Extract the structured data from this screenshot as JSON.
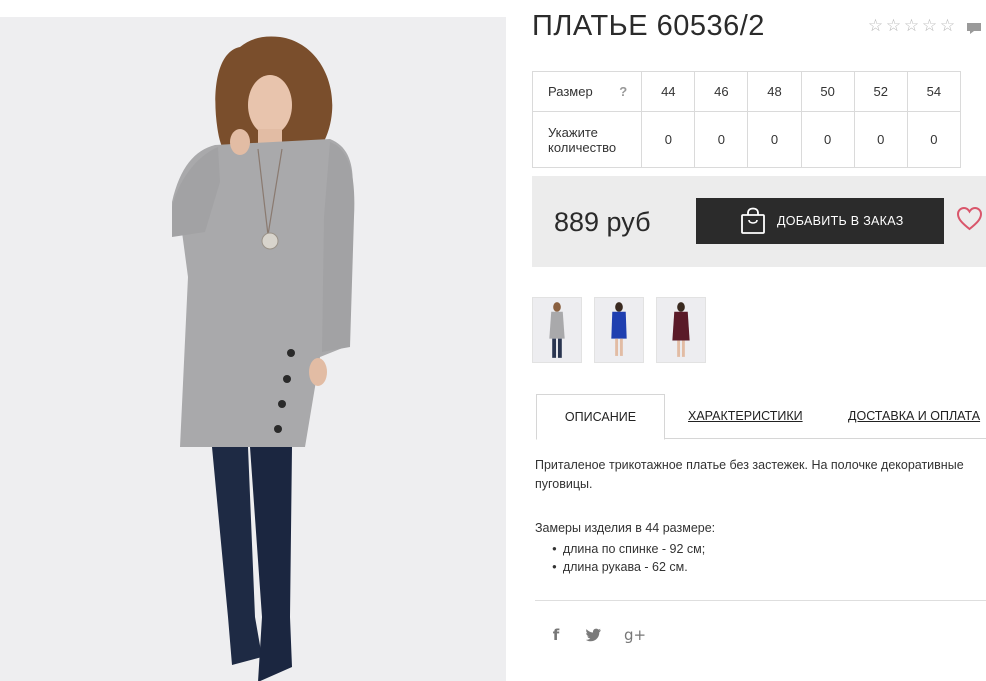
{
  "product": {
    "title": "ПЛАТЬЕ 60536/2",
    "rating_stars": 5,
    "rating_value": 0
  },
  "size_table": {
    "size_label": "Размер",
    "help_mark": "?",
    "qty_label": "Укажите количество",
    "sizes": [
      "44",
      "46",
      "48",
      "50",
      "52",
      "54"
    ],
    "quantities": [
      "0",
      "0",
      "0",
      "0",
      "0",
      "0"
    ]
  },
  "purchase": {
    "price": "889 руб",
    "add_button_label": "ДОБАВИТЬ В ЗАКАЗ"
  },
  "thumbnails": [
    {
      "color": "#a9a9ab"
    },
    {
      "color": "#1f3fb0"
    },
    {
      "color": "#5a1a28"
    }
  ],
  "tabs": [
    {
      "label": "ОПИСАНИЕ",
      "active": true
    },
    {
      "label": "ХАРАКТЕРИСТИКИ",
      "active": false
    },
    {
      "label": "ДОСТАВКА И ОПЛАТА",
      "active": false
    }
  ],
  "description": {
    "text": "Приталеное трикотажное платье без застежек. На полочке декоративные пуговицы.",
    "measurements_title": "Замеры изделия в 44 размере:",
    "measurements": [
      "длина по спинке - 92 см;",
      "длина рукава - 62 см."
    ]
  },
  "social": {
    "facebook": "f",
    "twitter": "t",
    "googleplus": "g+"
  },
  "colors": {
    "button_bg": "#2b2b2b",
    "price_box_bg": "#ececec",
    "heart": "#d9566b",
    "dress_main": "#a9a9ab"
  }
}
